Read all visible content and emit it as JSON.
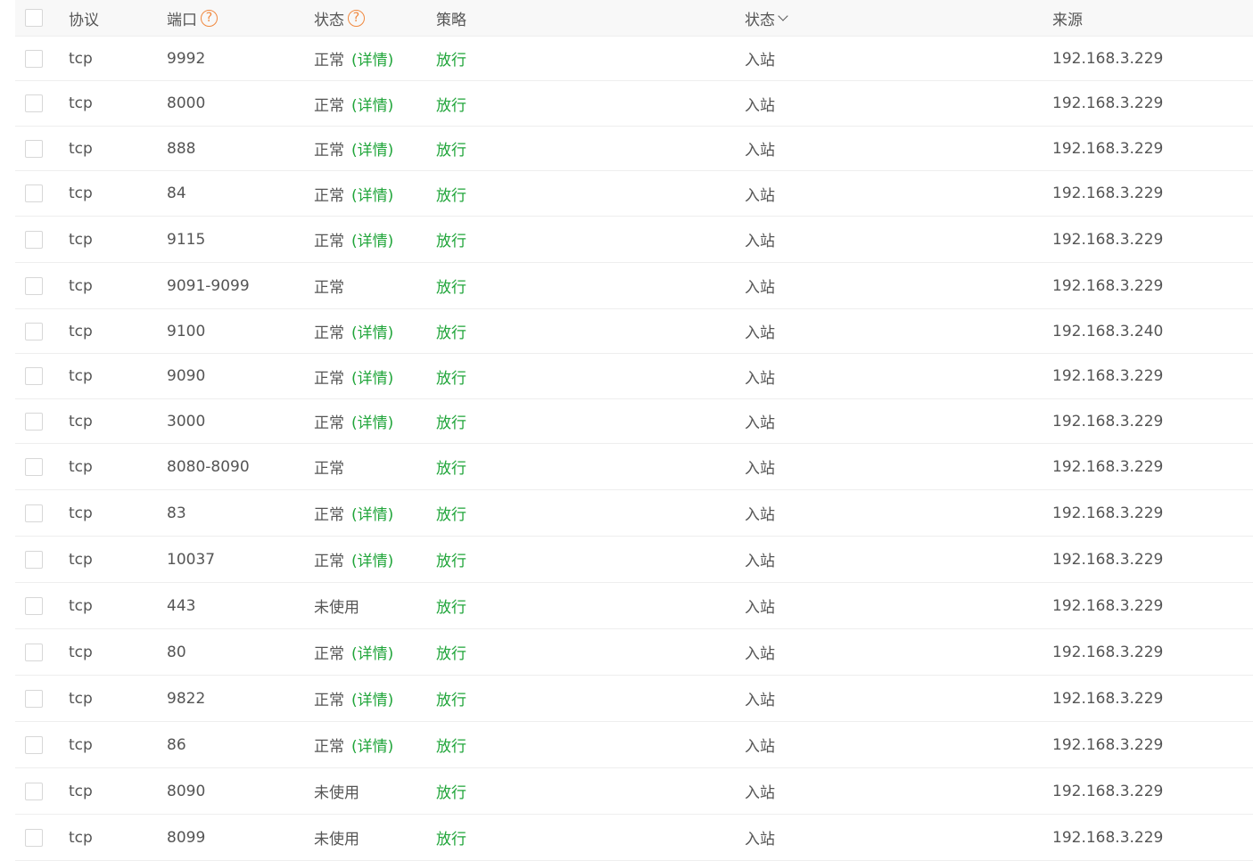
{
  "header": {
    "protocol": "协议",
    "port": "端口",
    "status": "状态",
    "policy": "策略",
    "direction": "状态",
    "source": "来源",
    "help_icon": "?",
    "chevron_icon": "chevron-down-icon"
  },
  "colors": {
    "accent_green": "#20a53a",
    "help_orange": "#f0883e"
  },
  "rows": [
    {
      "protocol": "tcp",
      "port": "9992",
      "status": "正常",
      "detail": "(详情)",
      "policy": "放行",
      "direction": "入站",
      "source": "192.168.3.229"
    },
    {
      "protocol": "tcp",
      "port": "8000",
      "status": "正常",
      "detail": "(详情)",
      "policy": "放行",
      "direction": "入站",
      "source": "192.168.3.229"
    },
    {
      "protocol": "tcp",
      "port": "888",
      "status": "正常",
      "detail": "(详情)",
      "policy": "放行",
      "direction": "入站",
      "source": "192.168.3.229"
    },
    {
      "protocol": "tcp",
      "port": "84",
      "status": "正常",
      "detail": "(详情)",
      "policy": "放行",
      "direction": "入站",
      "source": "192.168.3.229"
    },
    {
      "protocol": "tcp",
      "port": "9115",
      "status": "正常",
      "detail": "(详情)",
      "policy": "放行",
      "direction": "入站",
      "source": "192.168.3.229"
    },
    {
      "protocol": "tcp",
      "port": "9091-9099",
      "status": "正常",
      "detail": "",
      "policy": "放行",
      "direction": "入站",
      "source": "192.168.3.229"
    },
    {
      "protocol": "tcp",
      "port": "9100",
      "status": "正常",
      "detail": "(详情)",
      "policy": "放行",
      "direction": "入站",
      "source": "192.168.3.240"
    },
    {
      "protocol": "tcp",
      "port": "9090",
      "status": "正常",
      "detail": "(详情)",
      "policy": "放行",
      "direction": "入站",
      "source": "192.168.3.229"
    },
    {
      "protocol": "tcp",
      "port": "3000",
      "status": "正常",
      "detail": "(详情)",
      "policy": "放行",
      "direction": "入站",
      "source": "192.168.3.229"
    },
    {
      "protocol": "tcp",
      "port": "8080-8090",
      "status": "正常",
      "detail": "",
      "policy": "放行",
      "direction": "入站",
      "source": "192.168.3.229"
    },
    {
      "protocol": "tcp",
      "port": "83",
      "status": "正常",
      "detail": "(详情)",
      "policy": "放行",
      "direction": "入站",
      "source": "192.168.3.229"
    },
    {
      "protocol": "tcp",
      "port": "10037",
      "status": "正常",
      "detail": "(详情)",
      "policy": "放行",
      "direction": "入站",
      "source": "192.168.3.229"
    },
    {
      "protocol": "tcp",
      "port": "443",
      "status": "未使用",
      "detail": "",
      "policy": "放行",
      "direction": "入站",
      "source": "192.168.3.229"
    },
    {
      "protocol": "tcp",
      "port": "80",
      "status": "正常",
      "detail": "(详情)",
      "policy": "放行",
      "direction": "入站",
      "source": "192.168.3.229"
    },
    {
      "protocol": "tcp",
      "port": "9822",
      "status": "正常",
      "detail": "(详情)",
      "policy": "放行",
      "direction": "入站",
      "source": "192.168.3.229"
    },
    {
      "protocol": "tcp",
      "port": "86",
      "status": "正常",
      "detail": "(详情)",
      "policy": "放行",
      "direction": "入站",
      "source": "192.168.3.229"
    },
    {
      "protocol": "tcp",
      "port": "8090",
      "status": "未使用",
      "detail": "",
      "policy": "放行",
      "direction": "入站",
      "source": "192.168.3.229"
    },
    {
      "protocol": "tcp",
      "port": "8099",
      "status": "未使用",
      "detail": "",
      "policy": "放行",
      "direction": "入站",
      "source": "192.168.3.229"
    }
  ]
}
